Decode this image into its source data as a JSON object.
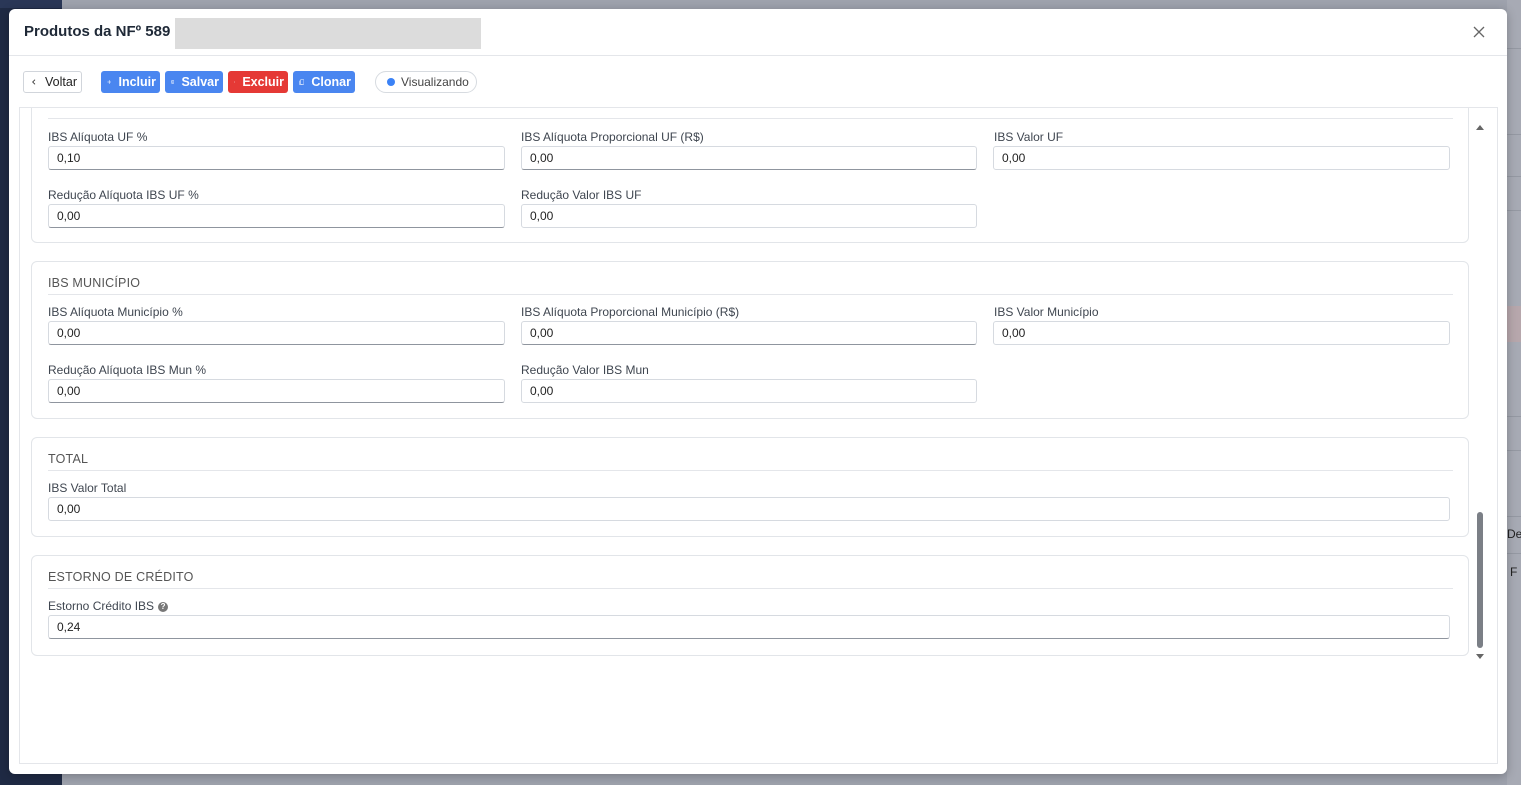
{
  "modal": {
    "title": "Produtos da NFº 589"
  },
  "toolbar": {
    "back_label": "Voltar",
    "add_label": "Incluir",
    "save_label": "Salvar",
    "delete_label": "Excluir",
    "clone_label": "Clonar",
    "status_label": "Visualizando"
  },
  "ibs_uf": {
    "aliquota_label": "IBS Alíquota UF %",
    "aliquota_value": "0,10",
    "proporcional_label": "IBS Alíquota Proporcional UF (R$)",
    "proporcional_value": "0,00",
    "valor_label": "IBS Valor UF",
    "valor_value": "0,00",
    "reducao_aliq_label": "Redução Alíquota IBS UF %",
    "reducao_aliq_value": "0,00",
    "reducao_valor_label": "Redução Valor IBS UF",
    "reducao_valor_value": "0,00"
  },
  "ibs_municipio": {
    "title": "IBS MUNICÍPIO",
    "aliquota_label": "IBS Alíquota Município %",
    "aliquota_value": "0,00",
    "proporcional_label": "IBS Alíquota Proporcional Município (R$)",
    "proporcional_value": "0,00",
    "valor_label": "IBS Valor Município",
    "valor_value": "0,00",
    "reducao_aliq_label": "Redução Alíquota IBS Mun %",
    "reducao_aliq_value": "0,00",
    "reducao_valor_label": "Redução Valor IBS Mun",
    "reducao_valor_value": "0,00"
  },
  "total": {
    "title": "TOTAL",
    "valor_label": "IBS Valor Total",
    "valor_value": "0,00"
  },
  "estorno": {
    "title": "ESTORNO DE CRÉDITO",
    "credito_label": "Estorno Crédito IBS",
    "credito_value": "0,24"
  },
  "background": {
    "right_text_1": "De",
    "right_text_2": "F"
  }
}
